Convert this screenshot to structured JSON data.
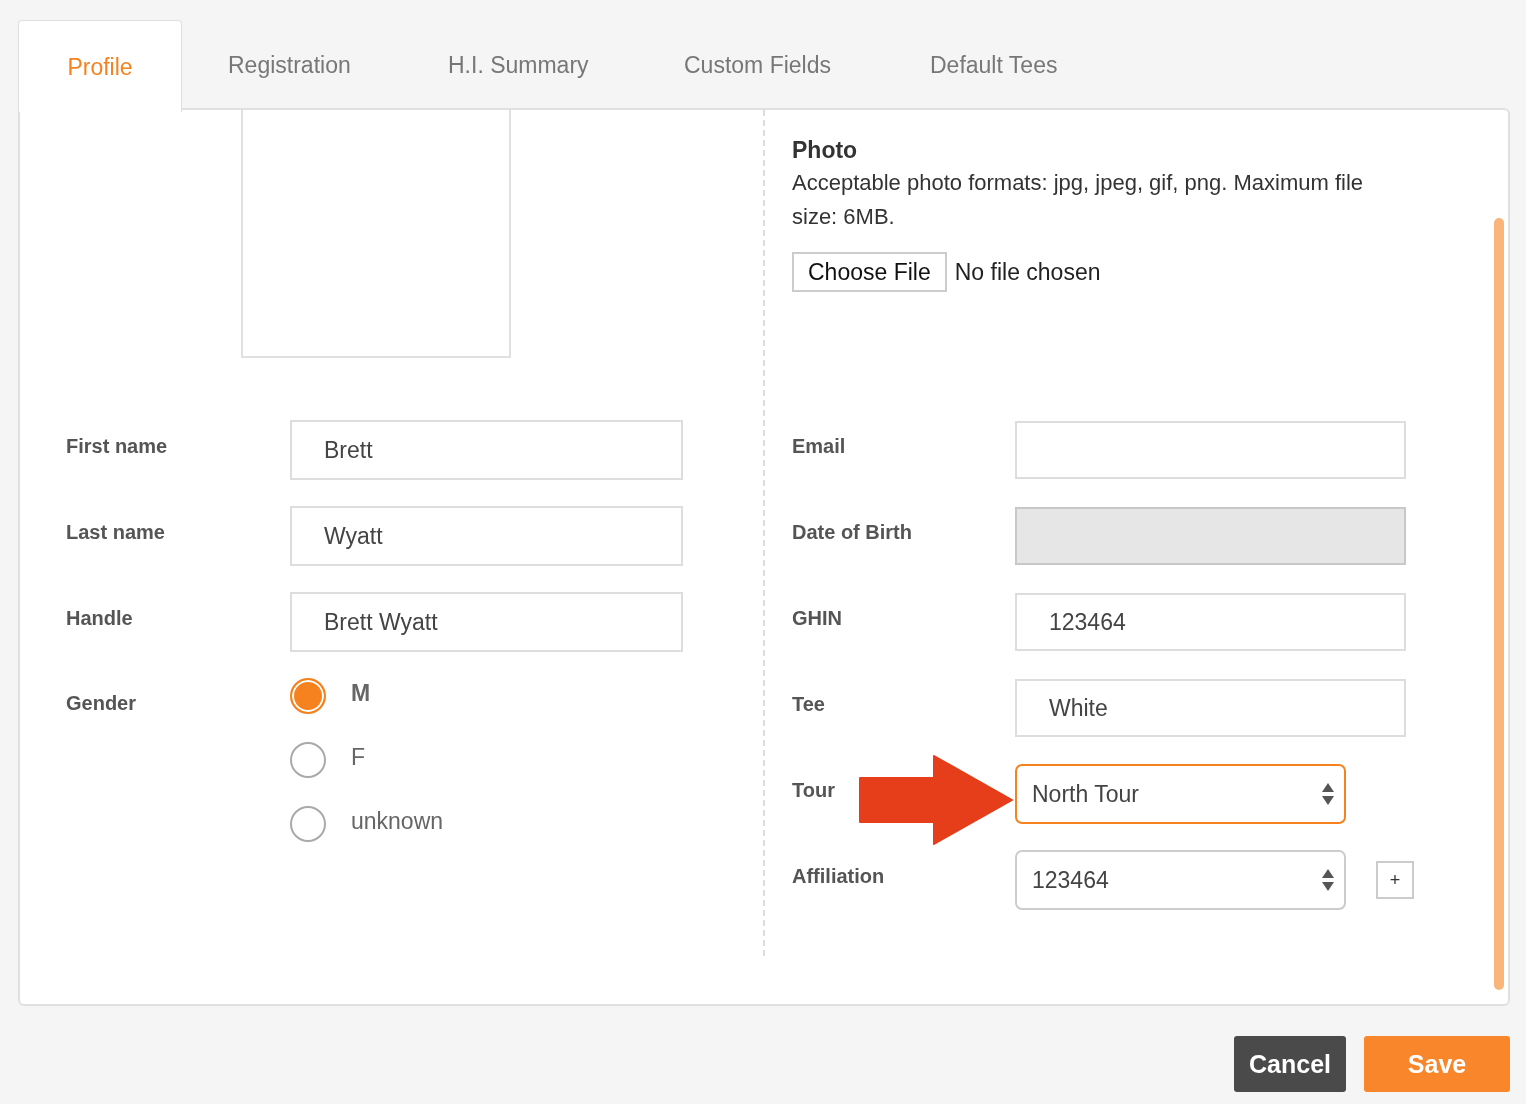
{
  "tabs": [
    {
      "label": "Profile",
      "selected": true
    },
    {
      "label": "Registration",
      "selected": false
    },
    {
      "label": "H.I. Summary",
      "selected": false
    },
    {
      "label": "Custom Fields",
      "selected": false
    },
    {
      "label": "Default Tees",
      "selected": false
    }
  ],
  "photo": {
    "title": "Photo",
    "description": "Acceptable photo formats: jpg, jpeg, gif, png. Maximum file size: 6MB.",
    "file_button": "Choose File",
    "file_status": "No file chosen"
  },
  "left_fields": [
    {
      "label": "First name",
      "value": "Brett"
    },
    {
      "label": "Last name",
      "value": "Wyatt"
    },
    {
      "label": "Handle",
      "value": "Brett Wyatt"
    }
  ],
  "gender": {
    "label": "Gender",
    "options": [
      {
        "label": "M",
        "selected": true
      },
      {
        "label": "F",
        "selected": false
      },
      {
        "label": "unknown",
        "selected": false
      }
    ]
  },
  "right_fields": [
    {
      "label": "Email",
      "kind": "text",
      "disabled": false
    },
    {
      "label": "Date of Birth",
      "kind": "text",
      "disabled": true
    },
    {
      "label": "GHIN",
      "kind": "text",
      "value": "123464",
      "disabled": false
    },
    {
      "label": "Tee",
      "kind": "text",
      "value": "White",
      "disabled": false
    },
    {
      "label": "Tour",
      "kind": "select",
      "value": "North Tour",
      "focused": true
    },
    {
      "label": "Affiliation",
      "kind": "select",
      "value": "123464",
      "focused": false,
      "add_button": "+"
    }
  ],
  "buttons": [
    {
      "label": "Cancel",
      "kind": "secondary"
    },
    {
      "label": "Save",
      "kind": "primary"
    }
  ]
}
